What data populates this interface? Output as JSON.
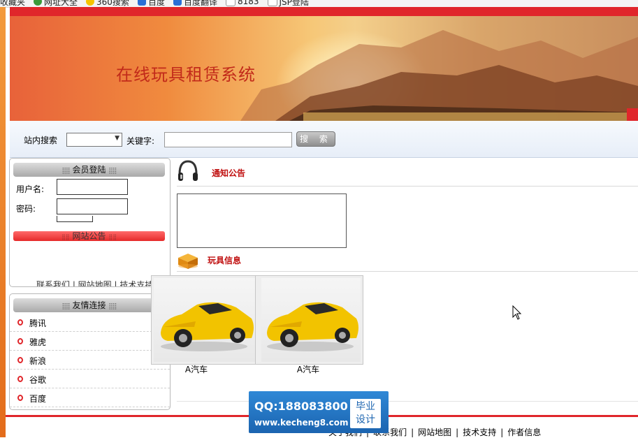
{
  "favorites_bar": {
    "items": [
      "收藏夹",
      "网址大全",
      "360搜索",
      "百度",
      "百度翻译",
      "8183",
      "JSP登陆"
    ]
  },
  "banner": {
    "title": "在线玩具租赁系统"
  },
  "search": {
    "site_search_label": "站内搜索",
    "select_value": "",
    "keyword_label": "关键字:",
    "keyword_value": "",
    "button_label": "搜 索"
  },
  "login_panel": {
    "title": "会员登陆",
    "username_label": "用户名:",
    "password_label": "密码:",
    "username_value": "",
    "password_value": "",
    "announcement_title": "网站公告",
    "clipped_text": "联系我们 | 网站地图 | 技术支持 | 作者信息"
  },
  "links_panel": {
    "title": "友情连接",
    "items": [
      "腾讯",
      "雅虎",
      "新浪",
      "谷歌",
      "百度"
    ]
  },
  "notice": {
    "title": "通知公告"
  },
  "toys": {
    "title": "玩具信息",
    "items": [
      {
        "label": "A汽车"
      },
      {
        "label": "A汽车"
      }
    ]
  },
  "footer": {
    "links": [
      "关于我们",
      "联系我们",
      "网站地图",
      "技术支持",
      "作者信息"
    ]
  },
  "watermark": {
    "qq": "QQ:188083800",
    "url": "www.kecheng8.com",
    "badge_line1": "毕业",
    "badge_line2": "设计"
  },
  "colors": {
    "accent_red": "#e0262b",
    "title_red": "#c22a1a",
    "section_red": "#c01010"
  }
}
